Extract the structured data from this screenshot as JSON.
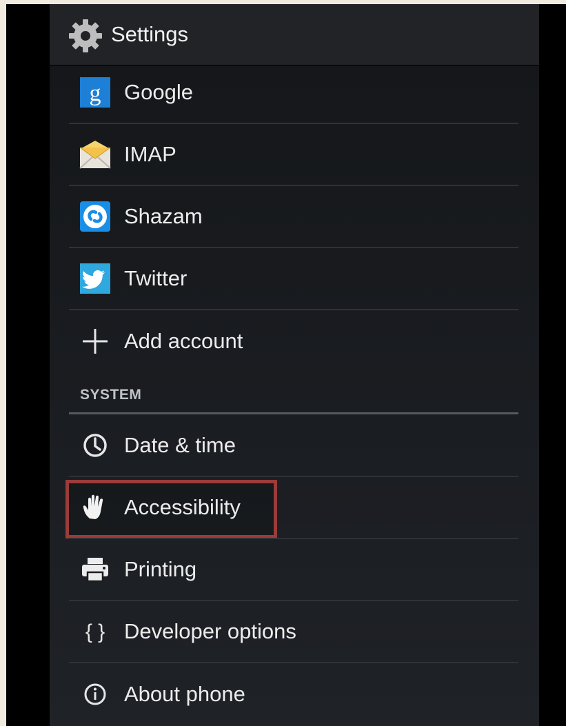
{
  "header": {
    "title": "Settings",
    "icon": "gear-icon"
  },
  "accounts": [
    {
      "label": "Google",
      "icon": "google-icon"
    },
    {
      "label": "IMAP",
      "icon": "email-icon"
    },
    {
      "label": "Shazam",
      "icon": "shazam-icon"
    },
    {
      "label": "Twitter",
      "icon": "twitter-icon"
    },
    {
      "label": "Add account",
      "icon": "plus-icon"
    }
  ],
  "system": {
    "header": "SYSTEM",
    "items": [
      {
        "label": "Date & time",
        "icon": "clock-icon"
      },
      {
        "label": "Accessibility",
        "icon": "hand-icon",
        "highlighted": true
      },
      {
        "label": "Printing",
        "icon": "printer-icon"
      },
      {
        "label": "Developer options",
        "icon": "braces-icon"
      },
      {
        "label": "About phone",
        "icon": "info-icon"
      }
    ]
  },
  "colors": {
    "highlight_border": "#9b3c3a",
    "google_blue": "#1e7fd6",
    "twitter_blue": "#2fa8e0"
  }
}
